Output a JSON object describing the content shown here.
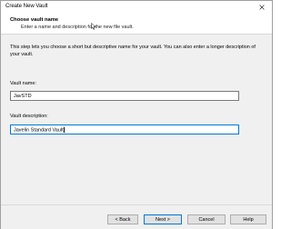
{
  "window": {
    "title": "Create New Vault"
  },
  "header": {
    "title": "Choose vault name",
    "subtitle": "Enter a name and description for the new file vault."
  },
  "content": {
    "description": "This step lets you choose a short but descriptive name for your vault. You can also enter a longer description of your vault.",
    "vault_name": {
      "label": "Vault name:",
      "value": "JavSTD"
    },
    "vault_description": {
      "label": "Vault description:",
      "value": "Javelin Standard Vault"
    }
  },
  "buttons": {
    "back": "< Back",
    "next": "Next >",
    "cancel": "Cancel",
    "help": "Help"
  },
  "icons": {
    "close": "close-icon",
    "pointer": "mouse-pointer-icon"
  },
  "colors": {
    "focus_border": "#0078d7",
    "dialog_background": "#f0f0f0",
    "header_background": "#ffffff"
  }
}
